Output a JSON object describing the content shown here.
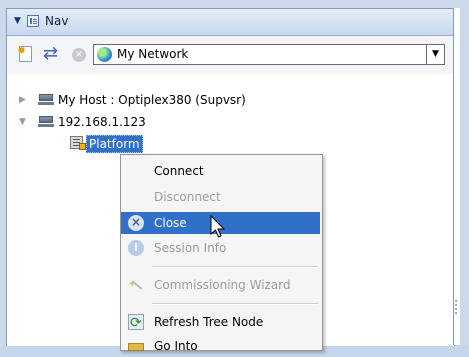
{
  "nav_tab": {
    "label": "Nav",
    "collapse_icon": "triangle-down-icon",
    "icon": "nav-tree-icon"
  },
  "toolbar": {
    "buttons": [
      {
        "icon": "new-document-icon"
      },
      {
        "icon": "sync-icon"
      },
      {
        "icon": "stop-icon",
        "enabled": false
      }
    ],
    "network_select": {
      "value": "My Network",
      "icon": "globe-icon"
    }
  },
  "tree": {
    "host": {
      "label": "My Host : Optiplex380 (Supvsr)",
      "expanded": false
    },
    "station": {
      "label": "192.168.1.123",
      "expanded": true
    },
    "platform": {
      "label": "Platform",
      "selected": true
    }
  },
  "context_menu": {
    "connect": "Connect",
    "disconnect": "Disconnect",
    "close": "Close",
    "session_info": "Session Info",
    "commissioning_wizard": "Commissioning Wizard",
    "refresh_tree_node": "Refresh Tree Node",
    "go_into": "Go Into",
    "highlight_color": "#3170c7"
  }
}
